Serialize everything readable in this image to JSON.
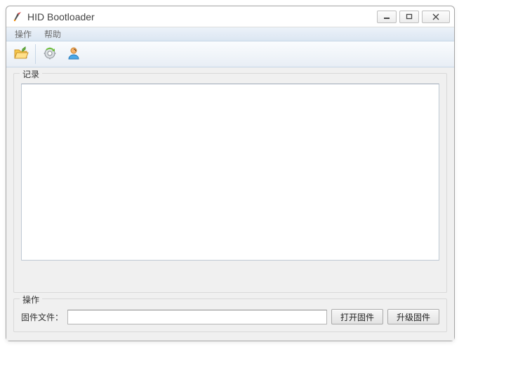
{
  "window": {
    "title": "HID Bootloader"
  },
  "menubar": {
    "items": [
      "操作",
      "帮助"
    ]
  },
  "toolbar": {
    "icons": [
      "open-folder-icon",
      "refresh-gear-icon",
      "user-icon"
    ]
  },
  "log_group": {
    "legend": "记录"
  },
  "ops_group": {
    "legend": "操作",
    "file_label": "固件文件：",
    "file_value": "",
    "open_button": "打开固件",
    "upgrade_button": "升级固件"
  }
}
